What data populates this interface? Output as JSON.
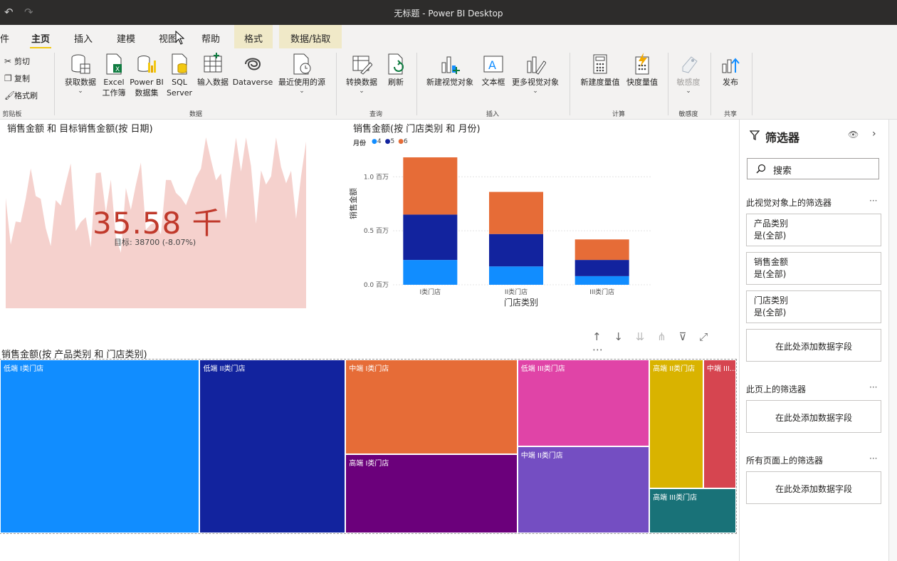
{
  "window": {
    "title": "无标题 - Power BI Desktop",
    "undo_icon": "↶",
    "redo_icon": "↷"
  },
  "tabs": [
    {
      "label": "件"
    },
    {
      "label": "主页"
    },
    {
      "label": "插入"
    },
    {
      "label": "建模"
    },
    {
      "label": "视图"
    },
    {
      "label": "帮助"
    },
    {
      "label": "格式"
    },
    {
      "label": "数据/钻取"
    }
  ],
  "ribbon": {
    "clipboard": {
      "cut": "剪切",
      "copy": "复制",
      "format_painter": "格式刷",
      "group": "剪贴板"
    },
    "data": {
      "get_data": "获取数据",
      "excel": [
        "Excel",
        "工作簿"
      ],
      "powerbi": [
        "Power BI",
        "数据集"
      ],
      "sql": [
        "SQL",
        "Server"
      ],
      "enter_data": "输入数据",
      "dataverse": "Dataverse",
      "recent": "最近使用的源",
      "group": "数据"
    },
    "query": {
      "transform": "转换数据",
      "refresh": "刷新",
      "group": "查询"
    },
    "insert": {
      "new_visual": "新建视觉对象",
      "textbox": "文本框",
      "more_visuals": "更多视觉对象",
      "group": "插入"
    },
    "calc": {
      "new_measure": "新建度量值",
      "quick_measure": "快度量值",
      "group": "计算"
    },
    "sensitivity": {
      "label": "敏感度",
      "group": "敏感度"
    },
    "share": {
      "publish": "发布",
      "group": "共享"
    }
  },
  "kpi": {
    "title": "销售金额 和 目标销售金额(按 日期)",
    "value": "35.58 千",
    "target_text": "目标: 38700 (-8.07%)"
  },
  "chart_data": [
    {
      "type": "bar",
      "stacked": true,
      "title": "销售金额(按 门店类别 和 月份)",
      "legend_title": "月份",
      "categories": [
        "I类门店",
        "II类门店",
        "III类门店"
      ],
      "series": [
        {
          "name": "4",
          "color": "#118dff",
          "values": [
            0.23,
            0.17,
            0.08
          ]
        },
        {
          "name": "5",
          "color": "#12239e",
          "values": [
            0.42,
            0.3,
            0.15
          ]
        },
        {
          "name": "6",
          "color": "#e66c37",
          "values": [
            0.53,
            0.39,
            0.19
          ]
        }
      ],
      "y_ticks": [
        "0.0 百万",
        "0.5 百万",
        "1.0 百万"
      ],
      "ylim": [
        0,
        1.2
      ],
      "xlabel": "门店类别",
      "ylabel": "销售金额",
      "grid": true,
      "legend_position": "top-left"
    },
    {
      "type": "treemap",
      "title": "销售金额(按 产品类别 和 门店类别)",
      "cells": [
        {
          "label": "低端 I类门店",
          "color": "#118dff",
          "value": 11.5
        },
        {
          "label": "低端 II类门店",
          "color": "#12239e",
          "value": 8.4
        },
        {
          "label": "中端 I类门店",
          "color": "#e66c37",
          "value": 5.4
        },
        {
          "label": "高端 I类门店",
          "color": "#6b007b",
          "value": 4.5
        },
        {
          "label": "低端 III类门店",
          "color": "#e044a7",
          "value": 3.8
        },
        {
          "label": "中端 II类门店",
          "color": "#744ec2",
          "value": 3.8
        },
        {
          "label": "高端 II类门店",
          "color": "#d9b300",
          "value": 2.3
        },
        {
          "label": "中端 III...",
          "color": "#d64550",
          "value": 1.4
        },
        {
          "label": "高端 III类门店",
          "color": "#197278",
          "value": 1.3
        }
      ]
    }
  ],
  "filters": {
    "title": "筛选器",
    "search_placeholder": "搜索",
    "visual_section": "此视觉对象上的筛选器",
    "visual_cards": [
      {
        "name": "产品类别",
        "state": "是(全部)"
      },
      {
        "name": "销售金额",
        "state": "是(全部)"
      },
      {
        "name": "门店类别",
        "state": "是(全部)"
      }
    ],
    "add_field": "在此处添加数据字段",
    "page_section": "此页上的筛选器",
    "all_pages_section": "所有页面上的筛选器",
    "more": "···"
  }
}
